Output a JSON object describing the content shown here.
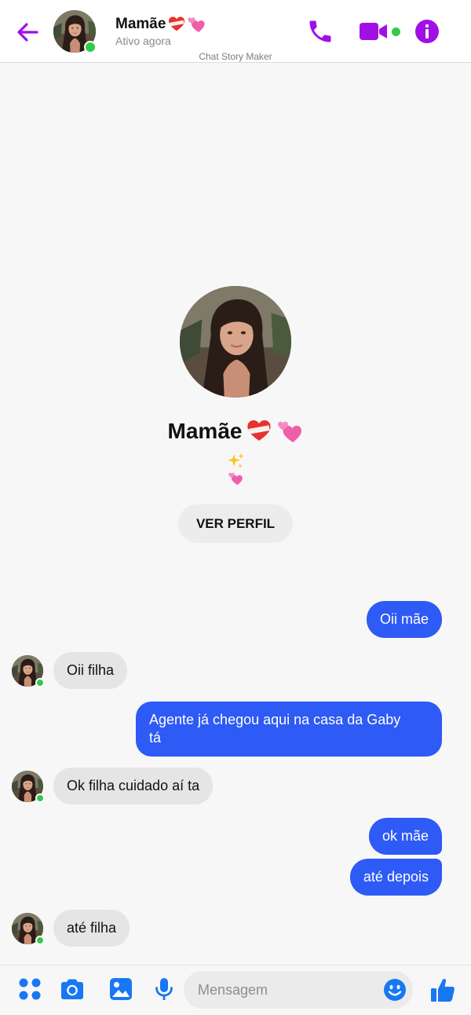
{
  "header": {
    "contact_name": "Mamãe",
    "status": "Ativo agora",
    "watermark": "Chat Story Maker"
  },
  "profile": {
    "name": "Mamãe",
    "view_profile_label": "VER PERFIL"
  },
  "messages": [
    {
      "direction": "out",
      "text": "Oii mãe"
    },
    {
      "direction": "in",
      "text": "Oii filha"
    },
    {
      "direction": "out",
      "lines": [
        "Agente já chegou aqui na casa da Gaby",
        "tá"
      ]
    },
    {
      "direction": "in",
      "text": "Ok filha cuidado aí ta"
    },
    {
      "direction": "out",
      "text": "ok mãe"
    },
    {
      "direction": "out",
      "text": "até depois"
    },
    {
      "direction": "in",
      "text": "até filha"
    }
  ],
  "composer": {
    "placeholder": "Mensagem"
  },
  "colors": {
    "accent": "#a10fe5",
    "outgoing_bubble": "#2e5af5",
    "incoming_bubble": "#e5e5e5",
    "composer_icons": "#1877f2",
    "online": "#35c84a"
  },
  "icons": {
    "header": [
      "back-arrow-icon",
      "phone-icon",
      "video-camera-icon",
      "info-icon"
    ],
    "composer": [
      "apps-menu-icon",
      "camera-icon",
      "gallery-icon",
      "microphone-icon",
      "emoji-icon",
      "thumbs-up-icon"
    ],
    "decorative": [
      "mended-heart-emoji",
      "revolving-hearts-emoji",
      "sparkles-emoji"
    ]
  }
}
